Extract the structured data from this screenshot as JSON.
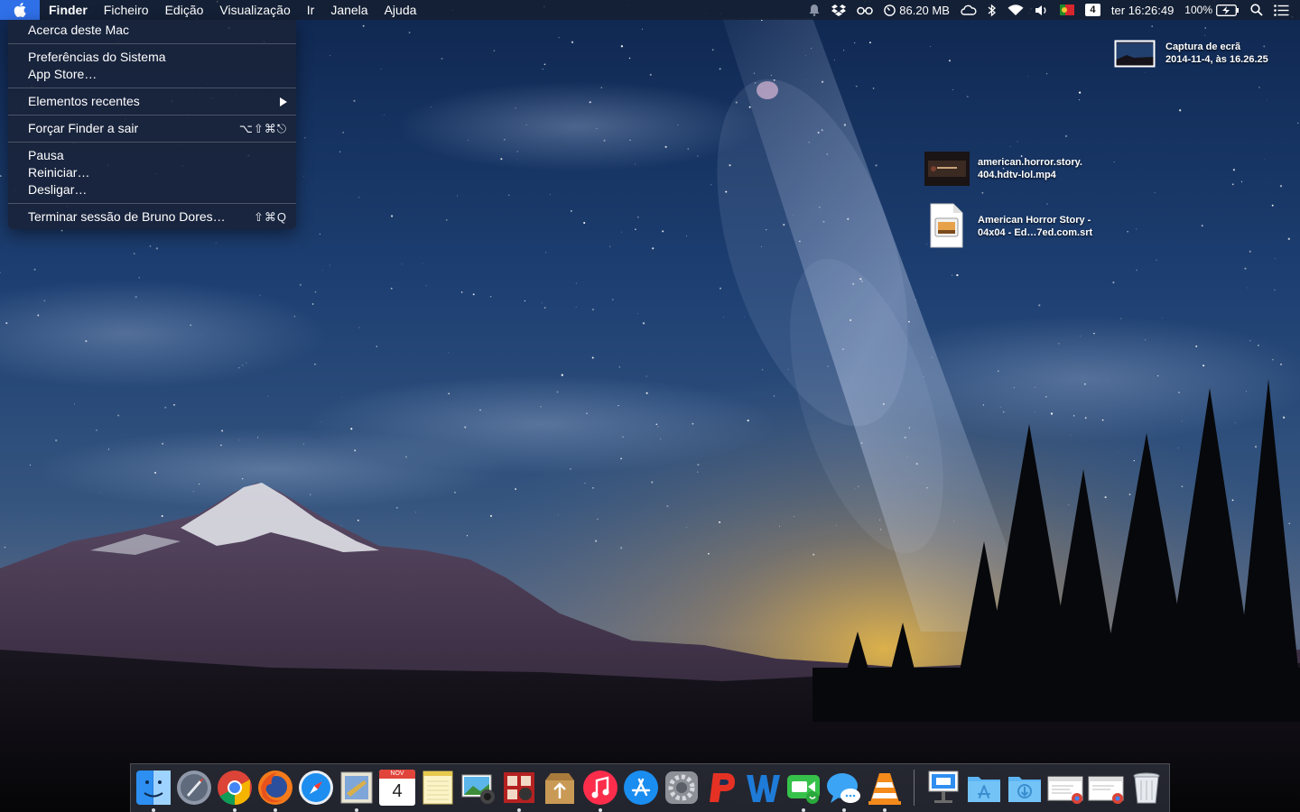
{
  "menubar": {
    "app_name": "Finder",
    "menus": [
      "Ficheiro",
      "Edição",
      "Visualização",
      "Ir",
      "Janela",
      "Ajuda"
    ],
    "memory": "86.20 MB",
    "notification_count": "4",
    "clock": "ter 16:26:49",
    "battery_percent": "100%"
  },
  "apple_menu": {
    "about": "Acerca deste Mac",
    "system_prefs": "Preferências do Sistema",
    "app_store": "App Store…",
    "recent_items": "Elementos recentes",
    "force_quit": "Forçar Finder a sair",
    "force_quit_shortcut": "⌥⇧⌘⎋",
    "sleep": "Pausa",
    "restart": "Reiniciar…",
    "shutdown": "Desligar…",
    "logout": "Terminar sessão de Bruno Dores…",
    "logout_shortcut": "⇧⌘Q"
  },
  "desktop": {
    "screenshot": {
      "line1": "Captura de ecrã",
      "line2": "2014-11-4, às 16.26.25"
    },
    "video": {
      "line1": "american.horror.story.",
      "line2": "404.hdtv-lol.mp4"
    },
    "subtitle": {
      "line1": "American Horror Story -",
      "line2": "04x04 - Ed…7ed.com.srt"
    }
  },
  "dock": {
    "calendar_month": "NOV",
    "calendar_day": "4",
    "apps": [
      "Finder",
      "Launchpad",
      "Google Chrome",
      "Firefox",
      "Safari",
      "Mail",
      "Calendar",
      "Notes",
      "iPhoto",
      "Photo Booth",
      "Archive Utility",
      "iTunes",
      "App Store",
      "System Preferences",
      "Polarr",
      "Word",
      "FaceTime",
      "Messages",
      "VLC",
      "Keynote",
      "Applications",
      "Downloads",
      "Chrome Document",
      "Chrome Document",
      "Trash"
    ]
  },
  "colors": {
    "menu_highlight": "#2f6fe8",
    "sky_top": "#0f2750",
    "sky_mid": "#3a5a8a",
    "horizon_glow": "#d9a540"
  }
}
